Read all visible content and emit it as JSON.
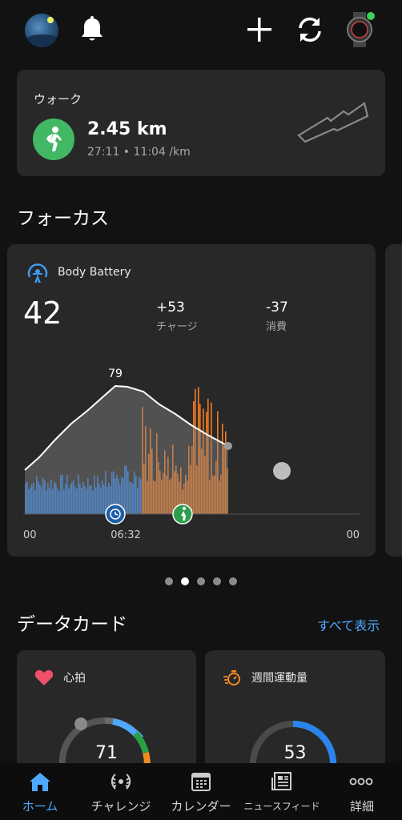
{
  "header": {
    "icons": [
      "profile-avatar",
      "bell-icon",
      "plus-icon",
      "sync-icon",
      "watch-icon"
    ],
    "watch_status_color": "#3ad15a"
  },
  "activity": {
    "title": "ウォーク",
    "distance": "2.45 km",
    "detail": "27:11 • 11:04 /km",
    "accent": "#43b864"
  },
  "focus": {
    "section_title": "フォーカス",
    "body_battery": {
      "title": "Body Battery",
      "value": "42",
      "charge_value": "+53",
      "charge_label": "チャージ",
      "drain_value": "-37",
      "drain_label": "消費",
      "peak_label": "79",
      "x_start": "00",
      "x_mid": "06:32",
      "x_end": "00",
      "colors": {
        "rest": "#2a84ec",
        "stress": "#f47b20",
        "level": "#ffffff"
      }
    },
    "pager": {
      "count": 5,
      "active": 1
    }
  },
  "data_cards": {
    "section_title": "データカード",
    "see_all": "すべて表示",
    "heart": {
      "title": "心拍",
      "value": "71",
      "icon_color": "#f0506a"
    },
    "intensity": {
      "title": "週間運動量",
      "value": "53",
      "icon_color": "#f08a24"
    }
  },
  "nav": {
    "items": [
      {
        "label": "ホーム",
        "active": true
      },
      {
        "label": "チャレンジ",
        "active": false
      },
      {
        "label": "カレンダー",
        "active": false
      },
      {
        "label": "ニュースフィード",
        "active": false
      },
      {
        "label": "詳細",
        "active": false
      }
    ]
  }
}
